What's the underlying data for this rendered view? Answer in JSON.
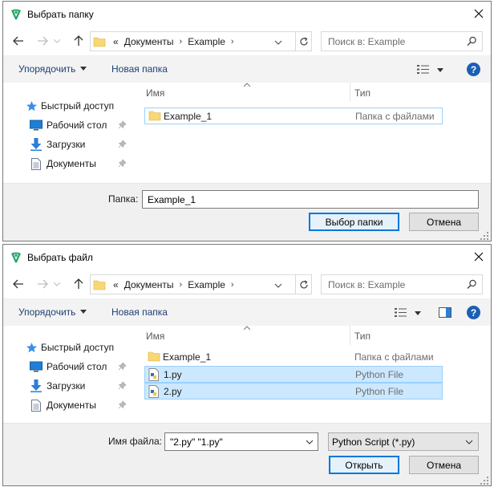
{
  "colors": {
    "accent": "#0078d7",
    "selection": "#cce8ff",
    "selection_border": "#99d1ff",
    "toolbar_bg": "#f3f3f3",
    "footer_bg": "#f0f0f0",
    "link": "#1e3f73",
    "folder": "#f8d775"
  },
  "dialog1": {
    "title": "Выбрать папку",
    "breadcrumb_prefix": "«",
    "breadcrumb": [
      "Документы",
      "Example"
    ],
    "search_placeholder": "Поиск в: Example",
    "toolbar": {
      "organize": "Упорядочить",
      "new_folder": "Новая папка"
    },
    "nav": {
      "quick_access": "Быстрый доступ",
      "items": [
        {
          "label": "Рабочий стол",
          "icon": "desktop-icon"
        },
        {
          "label": "Загрузки",
          "icon": "download-icon"
        },
        {
          "label": "Документы",
          "icon": "documents-icon"
        }
      ]
    },
    "columns": {
      "name": "Имя",
      "type": "Тип"
    },
    "files": [
      {
        "name": "Example_1",
        "type": "Папка с файлами",
        "icon": "folder-icon",
        "state": "focus"
      }
    ],
    "footer": {
      "folder_label": "Папка:",
      "folder_value": "Example_1",
      "select_button": "Выбор папки",
      "cancel_button": "Отмена"
    }
  },
  "dialog2": {
    "title": "Выбрать файл",
    "breadcrumb_prefix": "«",
    "breadcrumb": [
      "Документы",
      "Example"
    ],
    "search_placeholder": "Поиск в: Example",
    "toolbar": {
      "organize": "Упорядочить",
      "new_folder": "Новая папка"
    },
    "nav": {
      "quick_access": "Быстрый доступ",
      "items": [
        {
          "label": "Рабочий стол",
          "icon": "desktop-icon"
        },
        {
          "label": "Загрузки",
          "icon": "download-icon"
        },
        {
          "label": "Документы",
          "icon": "documents-icon"
        }
      ]
    },
    "columns": {
      "name": "Имя",
      "type": "Тип"
    },
    "files": [
      {
        "name": "Example_1",
        "type": "Папка с файлами",
        "icon": "folder-icon",
        "state": "normal"
      },
      {
        "name": "1.py",
        "type": "Python File",
        "icon": "python-file-icon",
        "state": "selected"
      },
      {
        "name": "2.py",
        "type": "Python File",
        "icon": "python-file-icon",
        "state": "selected-focus"
      }
    ],
    "footer": {
      "filename_label": "Имя файла:",
      "filename_value": "\"2.py\" \"1.py\"",
      "filetype_value": "Python Script (*.py)",
      "open_button": "Открыть",
      "cancel_button": "Отмена"
    }
  }
}
